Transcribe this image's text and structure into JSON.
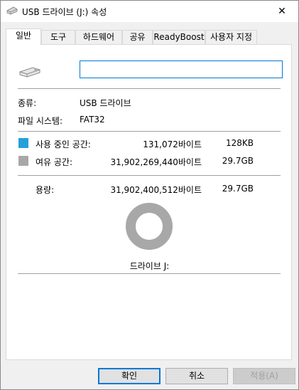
{
  "window": {
    "title": "USB 드라이브 (J:) 속성",
    "drive_icon": "usb-drive-icon",
    "close_glyph": "✕"
  },
  "tabs": [
    {
      "label": "일반",
      "active": true
    },
    {
      "label": "도구"
    },
    {
      "label": "하드웨어"
    },
    {
      "label": "공유"
    },
    {
      "label": "ReadyBoost"
    },
    {
      "label": "사용자 지정"
    }
  ],
  "general": {
    "volume_label_value": "",
    "type_label": "종류:",
    "type_value": "USB 드라이브",
    "fs_label": "파일 시스템:",
    "fs_value": "FAT32",
    "used": {
      "label": "사용 중인 공간:",
      "bytes": "131,072바이트",
      "size": "128KB",
      "color": "#26a0da"
    },
    "free": {
      "label": "여유 공간:",
      "bytes": "31,902,269,440바이트",
      "size": "29.7GB",
      "color": "#a8a8a8"
    },
    "capacity": {
      "label": "용량:",
      "bytes": "31,902,400,512바이트",
      "size": "29.7GB"
    },
    "used_fraction": 4e-06,
    "drive_caption": "드라이브 J:"
  },
  "buttons": {
    "ok": "확인",
    "cancel": "취소",
    "apply": "적용(A)"
  }
}
